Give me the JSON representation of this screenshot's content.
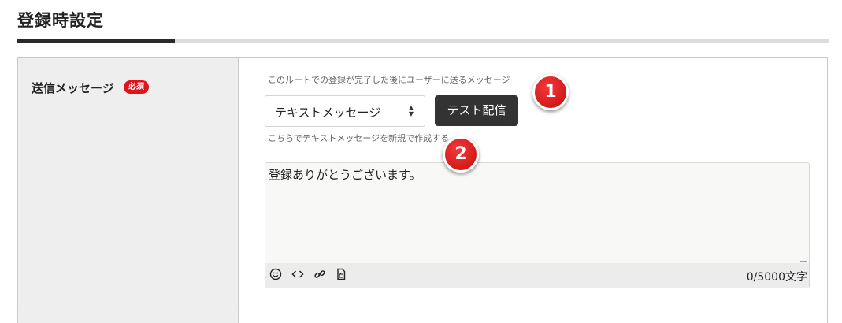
{
  "header": {
    "title": "登録時設定"
  },
  "field": {
    "label": "送信メッセージ",
    "required_badge": "必須",
    "hint_top": "このルートでの登録が完了した後にユーザーに送るメッセージ",
    "type_select": {
      "selected": "テキストメッセージ"
    },
    "test_button": "テスト配信",
    "hint_bottom": "こちらでテキストメッセージを新規で作成する",
    "message_value": "登録ありがとうございます。",
    "char_count": "0/5000文字",
    "toolbar_icons": [
      "emoji-icon",
      "code-icon",
      "link-icon",
      "file-icon"
    ]
  },
  "callouts": {
    "one": "1",
    "two": "2"
  },
  "colors": {
    "badge": "#e0121b",
    "button": "#333333",
    "callout": "#d81414",
    "label_bg": "#eeeeee"
  }
}
